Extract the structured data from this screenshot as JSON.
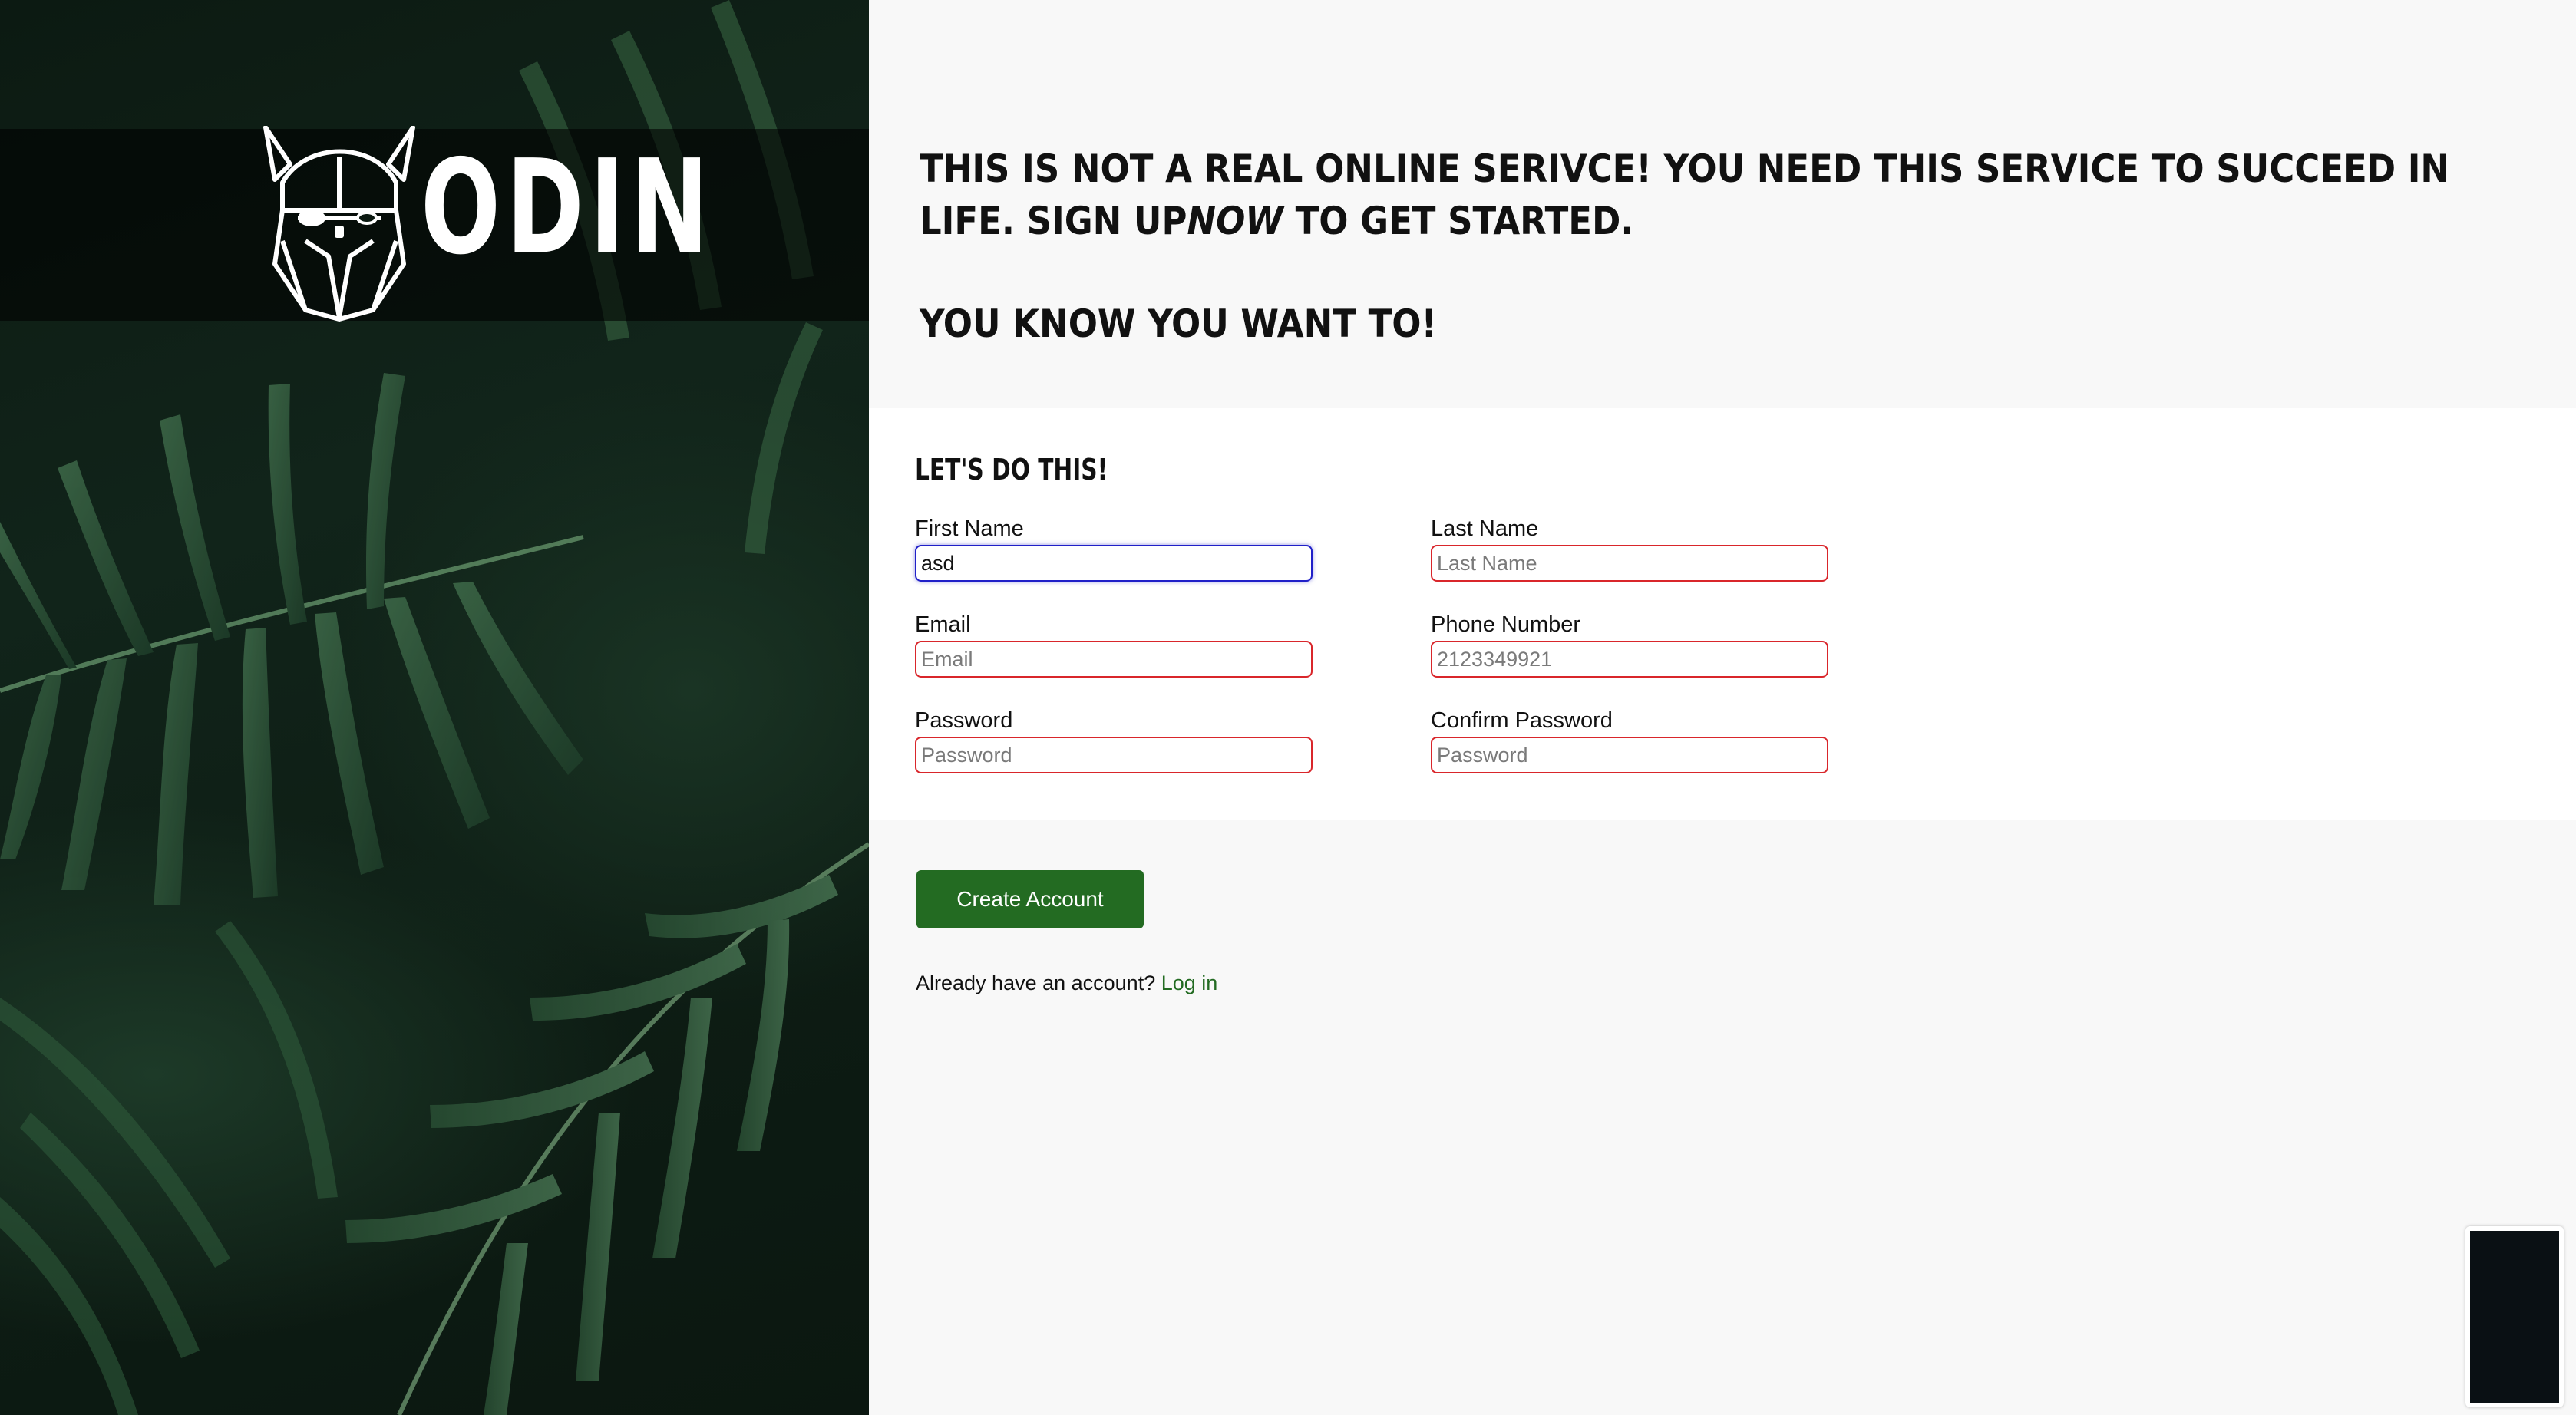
{
  "brand": {
    "name": "ODIN"
  },
  "intro": {
    "line1_before": "This is not a real online serivce! You need this service to succeed in life. Sign up",
    "line1_emphasis": "now",
    "line1_after": " to get started.",
    "line2": "You know you want to!"
  },
  "form": {
    "title": "Let's do this!",
    "fields": {
      "first_name": {
        "label": "First Name",
        "value": "asd",
        "placeholder": "First Name"
      },
      "last_name": {
        "label": "Last Name",
        "value": "",
        "placeholder": "Last Name"
      },
      "email": {
        "label": "Email",
        "value": "",
        "placeholder": "Email"
      },
      "phone": {
        "label": "Phone Number",
        "value": "",
        "placeholder": "2123349921"
      },
      "password": {
        "label": "Password",
        "value": "",
        "placeholder": "Password"
      },
      "confirm_password": {
        "label": "Confirm Password",
        "value": "",
        "placeholder": "Password"
      }
    }
  },
  "actions": {
    "create_account_label": "Create Account",
    "login_prompt": "Already have an account?",
    "login_link": "Log in"
  },
  "colors": {
    "accent_green": "#236b22",
    "invalid_border": "#d9262b",
    "focus_border": "#2020c8",
    "hero_dark": "#0c1a12"
  },
  "icons": {
    "logo": "viking-helmet-logo-icon"
  }
}
